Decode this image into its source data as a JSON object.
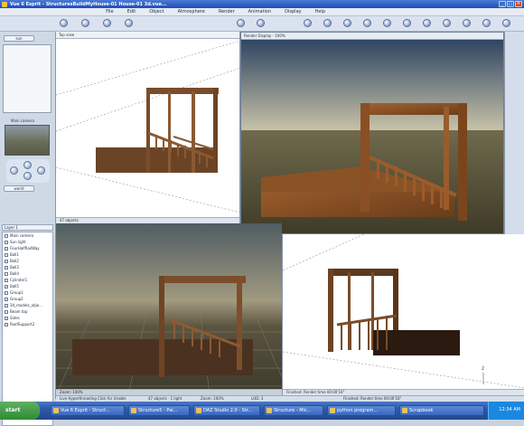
{
  "window": {
    "title": "Vue 6 Esprit - StructuresBuildMyHouse-01 House-01 3d.vue...",
    "btn_min": "_",
    "btn_max": "□",
    "btn_close": "×"
  },
  "menu": [
    "File",
    "Edit",
    "Object",
    "Atmosphere",
    "Render",
    "Animation",
    "Display",
    "Help"
  ],
  "left_panel": {
    "tab_a": "sun",
    "tab_b": "world",
    "camera_label": "Main camera",
    "list_header": "Layer 1"
  },
  "scene_items": [
    "Main camera",
    "Sun light",
    "FourHalfRailWay",
    "Ball1",
    "Ball2",
    "Ball3",
    "Ball4",
    "Cylinder1",
    "Ball5",
    "Group1",
    "Group2",
    "3d_models_obje...",
    "Beam top",
    "Sides",
    "RoofSupport2"
  ],
  "viewports": {
    "topleft": {
      "header": "Top view",
      "footer": "47 objects"
    },
    "main": {
      "header": "Render Display - 100%"
    },
    "bottomleft": {
      "footer": "Zoom: 100%"
    },
    "bottomright": {
      "footer": "Finished: Render time 00:00'16\""
    }
  },
  "status": {
    "left": "Live Hyperthreading Click for Unable",
    "middle": "47 objects · 1 light",
    "zoom": "Zoom: 100%",
    "lod": "LOD: 3",
    "right": "Finished: Render time 00:00'16\""
  },
  "taskbar": {
    "start": "start",
    "tasks": [
      "Vue 6 Esprit - Struct...",
      "Structure5 - Pai...",
      "DAZ Studio 2.0 - Str...",
      "Structure - Mic...",
      "python program...",
      "Scrapbook"
    ],
    "clock": "12:34 AM"
  }
}
